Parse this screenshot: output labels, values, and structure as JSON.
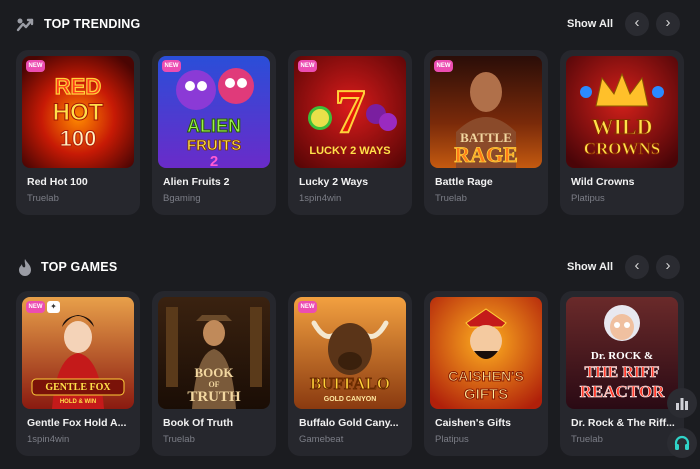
{
  "trending": {
    "title": "TOP TRENDING",
    "show_all": "Show All",
    "icon": "flame-chart-icon",
    "games": [
      {
        "name": "Red Hot 100",
        "provider": "Truelab",
        "badge": "NEW",
        "art_text": [
          "RED",
          "HOT",
          "100"
        ]
      },
      {
        "name": "Alien Fruits 2",
        "provider": "Bgaming",
        "badge": "NEW",
        "art_text": [
          "ALIEN",
          "FRUITS",
          "2"
        ]
      },
      {
        "name": "Lucky 2 Ways",
        "provider": "1spin4win",
        "badge": "NEW",
        "art_text": [
          "7",
          "LUCKY 2 WAYS"
        ]
      },
      {
        "name": "Battle Rage",
        "provider": "Truelab",
        "badge": "NEW",
        "art_text": [
          "BATTLE",
          "RAGE"
        ]
      },
      {
        "name": "Wild Crowns",
        "provider": "Platipus",
        "badge": "",
        "art_text": [
          "WILD",
          "CROWNS"
        ]
      }
    ]
  },
  "top_games": {
    "title": "TOP GAMES",
    "show_all": "Show All",
    "icon": "flame-icon",
    "games": [
      {
        "name": "Gentle Fox Hold A...",
        "provider": "1spin4win",
        "badge": "NEW",
        "art_text": [
          "GENTLE FOX",
          "HOLD & WIN"
        ]
      },
      {
        "name": "Book Of Truth",
        "provider": "Truelab",
        "badge": "",
        "art_text": [
          "BOOK",
          "OF",
          "TRUTH"
        ]
      },
      {
        "name": "Buffalo Gold Cany...",
        "provider": "Gamebeat",
        "badge": "NEW",
        "art_text": [
          "BUFFALO",
          "GOLD CANYON"
        ]
      },
      {
        "name": "Caishen's Gifts",
        "provider": "Platipus",
        "badge": "",
        "art_text": [
          "CAISHEN'S",
          "GIFTS"
        ]
      },
      {
        "name": "Dr. Rock & The Riff...",
        "provider": "Truelab",
        "badge": "",
        "art_text": [
          "Dr. ROCK &",
          "THE RIFF",
          "REACTOR"
        ]
      }
    ]
  },
  "nav": {
    "prev": "‹",
    "next": "›"
  },
  "colors": {
    "background": "#1b1c20",
    "card": "#26272d",
    "badge_new": "#ec4db2",
    "provider_text": "#7c7e87"
  }
}
